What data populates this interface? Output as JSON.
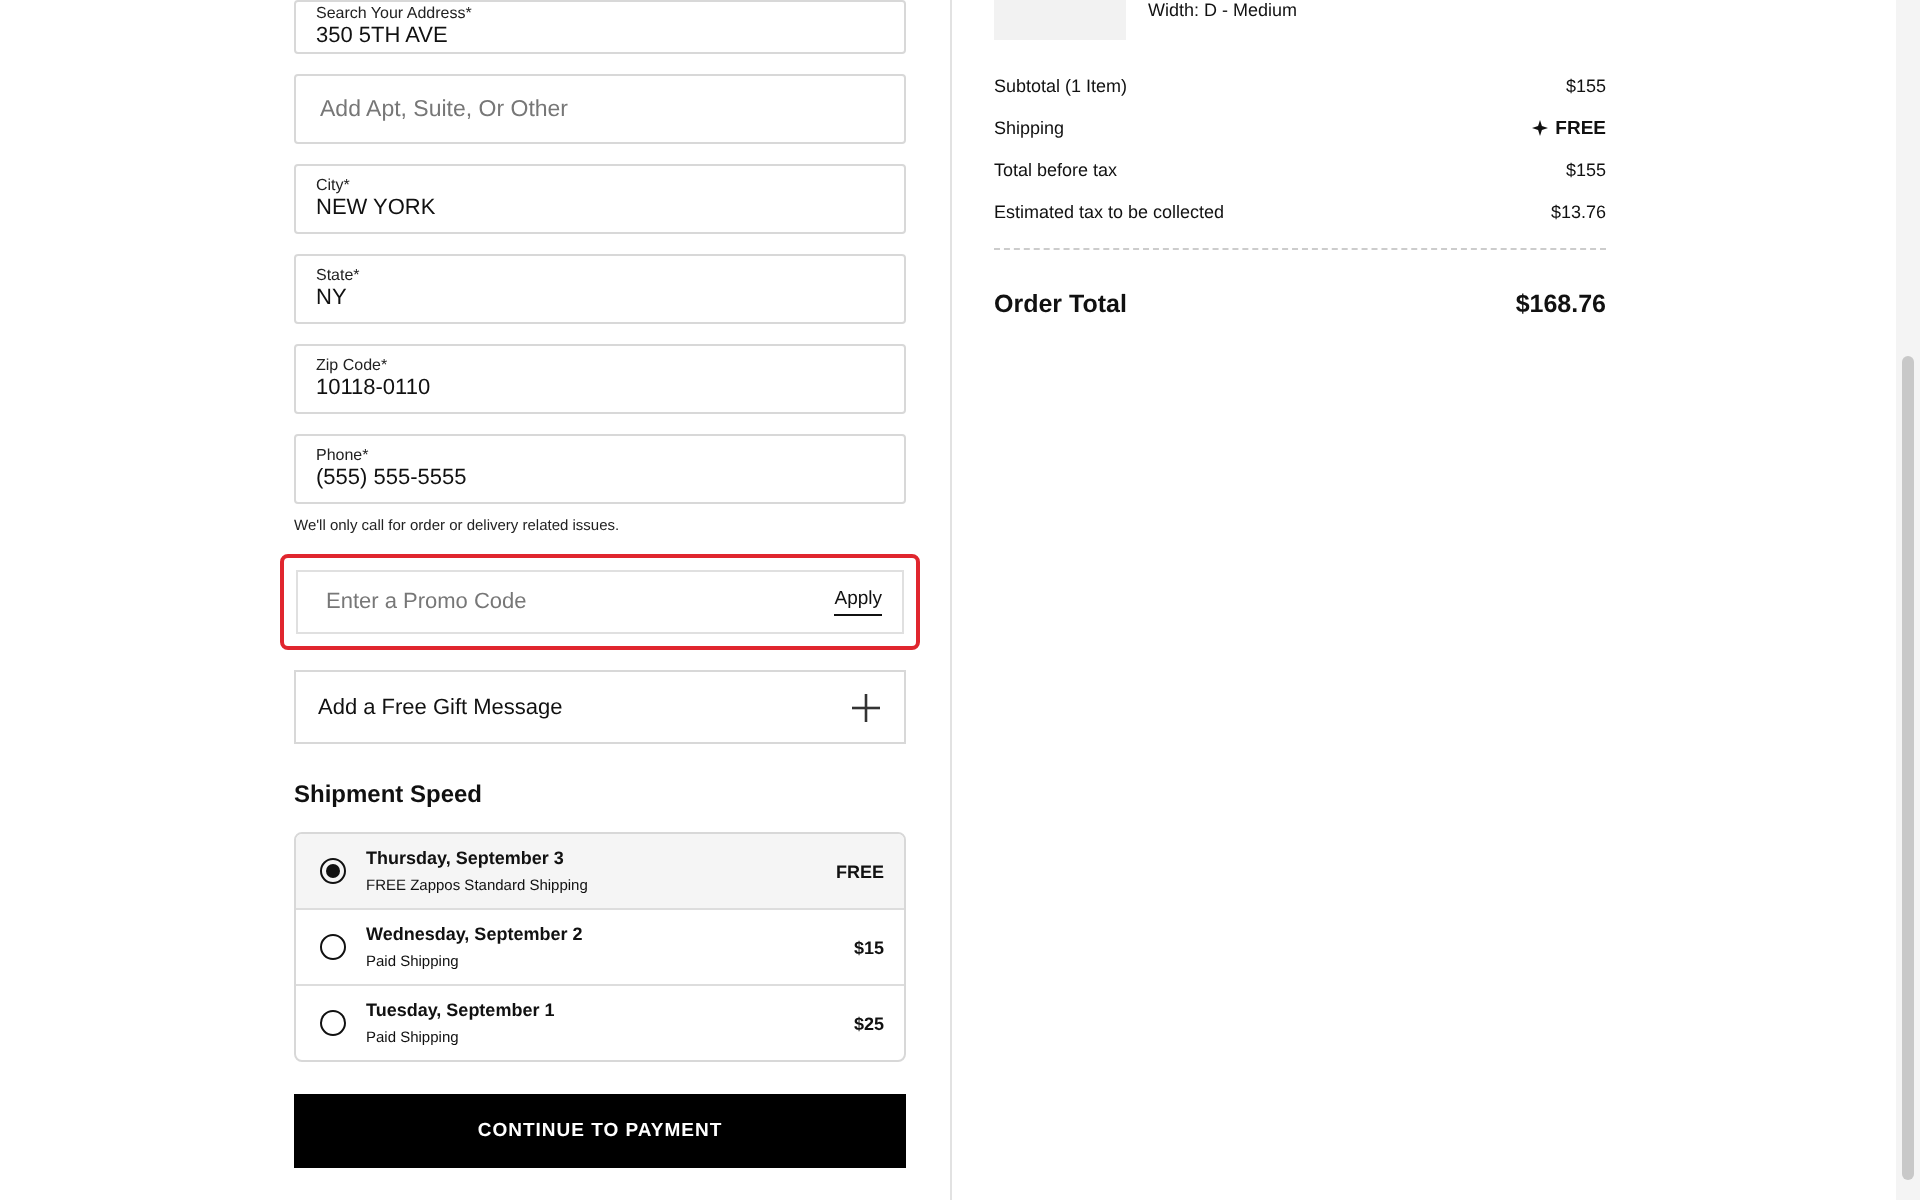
{
  "address_fields": [
    {
      "label": "Search Your Address*",
      "value": "350 5TH AVE"
    },
    {
      "placeholder": "Add Apt, Suite, Or Other"
    },
    {
      "label": "City*",
      "value": "NEW YORK"
    },
    {
      "label": "State*",
      "value": "NY"
    },
    {
      "label": "Zip Code*",
      "value": "10118-0110"
    },
    {
      "label": "Phone*",
      "value": "(555) 555-5555"
    }
  ],
  "phone_note": "We'll only call for order or delivery related issues.",
  "promo": {
    "placeholder": "Enter a Promo Code",
    "button": "Apply",
    "highlighted": true
  },
  "gift_message": {
    "label": "Add a Free Gift Message",
    "expanded": false
  },
  "shipment_speed": {
    "title": "Shipment Speed",
    "options": [
      {
        "date": "Thursday, September 3",
        "detail": "FREE Zappos Standard Shipping",
        "price": "FREE",
        "selected": true
      },
      {
        "date": "Wednesday, September 2",
        "detail": "Paid Shipping",
        "price": "$15",
        "selected": false
      },
      {
        "date": "Tuesday, September 1",
        "detail": "Paid Shipping",
        "price": "$25",
        "selected": false
      }
    ]
  },
  "continue_button": "CONTINUE TO PAYMENT",
  "order_item": {
    "width": "Width: D - Medium"
  },
  "summary": {
    "rows": [
      {
        "label": "Subtotal (1 Item)",
        "value": "$155",
        "kind": "plain"
      },
      {
        "label": "Shipping",
        "value": "FREE",
        "kind": "free"
      },
      {
        "label": "Total before tax",
        "value": "$155",
        "kind": "plain"
      },
      {
        "label": "Estimated tax to be collected",
        "value": "$13.76",
        "kind": "plain"
      }
    ],
    "total_label": "Order Total",
    "total_value": "$168.76"
  }
}
